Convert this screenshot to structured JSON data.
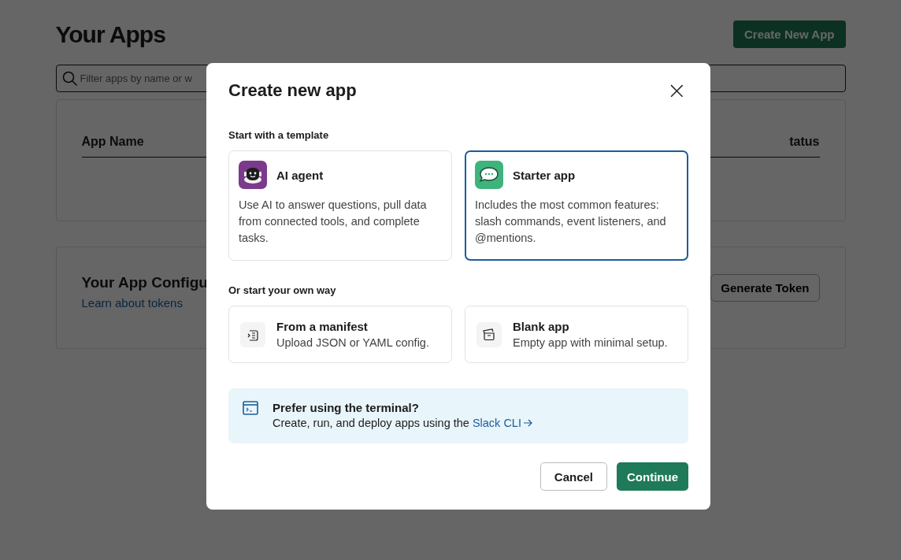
{
  "page": {
    "title": "Your Apps",
    "create_button": "Create New App",
    "search": {
      "placeholder": "Filter apps by name or w"
    },
    "table": {
      "columns": [
        "App Name",
        "tatus"
      ]
    },
    "config": {
      "title": "Your App Configu",
      "link": "Learn about tokens",
      "button": "Generate Token"
    }
  },
  "dialog": {
    "title": "Create new app",
    "close": "×",
    "template_heading": "Start with a template",
    "templates": [
      {
        "kind": "agent",
        "title": "AI agent",
        "description": "Use AI to answer questions, pull data from connected tools, and complete tasks.",
        "selected": false
      },
      {
        "kind": "starter",
        "title": "Starter app",
        "description": "Includes the most common features: slash commands, event listeners, and @mentions.",
        "selected": true
      }
    ],
    "own_heading": "Or start your own way",
    "options": [
      {
        "kind": "manifest",
        "title": "From a manifest",
        "description": "Upload JSON or YAML config.",
        "selected": false
      },
      {
        "kind": "blank",
        "title": "Blank app",
        "description": "Empty app with minimal setup.",
        "selected": false
      }
    ],
    "banner": {
      "title": "Prefer using the terminal?",
      "text": "Create, run, and deploy apps using the",
      "link": "Slack CLI"
    },
    "buttons": {
      "cancel": "Cancel",
      "continue": "Continue"
    }
  }
}
